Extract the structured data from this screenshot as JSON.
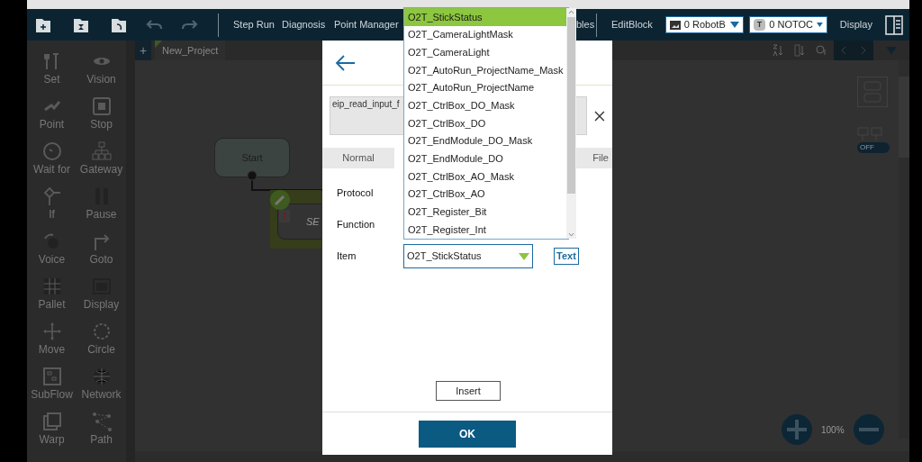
{
  "toolbar": {
    "menu": [
      "Step Run",
      "Diagnosis",
      "Point Manager",
      "bles"
    ],
    "edit_block": "EditBlock",
    "selectors": [
      {
        "text": "0 RobotB"
      },
      {
        "badge": "T",
        "text": "0 NOTOC"
      }
    ],
    "display": "Display"
  },
  "add_tab": "+",
  "project_tab": "New_Project",
  "palette": [
    "Set",
    "Vision",
    "Point",
    "Stop",
    "Wait for",
    "Gateway",
    "If",
    "Pause",
    "Voice",
    "Goto",
    "Pallet",
    "Display",
    "Move",
    "Circle",
    "SubFlow",
    "Network",
    "Warp",
    "Path"
  ],
  "flow": {
    "start": "Start",
    "block_label": "SE"
  },
  "side_toggle": {
    "label": "OFF",
    "on": false
  },
  "zoom": {
    "reading": "100%"
  },
  "dialog": {
    "name_field": "eip_read_input_f",
    "tabs": [
      {
        "label": "Normal",
        "selected": false
      },
      {
        "label": "File",
        "selected": false
      }
    ],
    "fields": [
      {
        "label": "Protocol"
      },
      {
        "label": "Function"
      },
      {
        "label": "Item",
        "value": "O2T_StickStatus",
        "button": "Text"
      }
    ],
    "insert": "Insert",
    "ok": "OK"
  },
  "dropdown": {
    "options": [
      {
        "label": "O2T_StickStatus",
        "selected": true
      },
      {
        "label": "O2T_CameraLightMask",
        "selected": false
      },
      {
        "label": "O2T_CameraLight",
        "selected": false
      },
      {
        "label": "O2T_AutoRun_ProjectName_Mask",
        "selected": false
      },
      {
        "label": "O2T_AutoRun_ProjectName",
        "selected": false
      },
      {
        "label": "O2T_CtrlBox_DO_Mask",
        "selected": false
      },
      {
        "label": "O2T_CtrlBox_DO",
        "selected": false
      },
      {
        "label": "O2T_EndModule_DO_Mask",
        "selected": false
      },
      {
        "label": "O2T_EndModule_DO",
        "selected": false
      },
      {
        "label": "O2T_CtrlBox_AO_Mask",
        "selected": false
      },
      {
        "label": "O2T_CtrlBox_AO",
        "selected": false
      },
      {
        "label": "O2T_Register_Bit",
        "selected": false
      },
      {
        "label": "O2T_Register_Int",
        "selected": false
      }
    ]
  }
}
